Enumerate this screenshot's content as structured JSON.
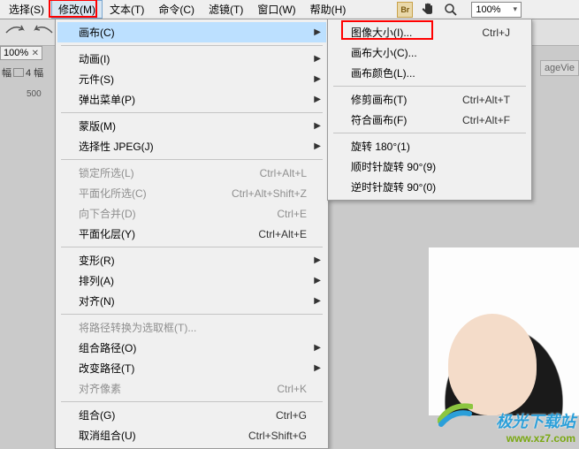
{
  "menubar": {
    "items": [
      {
        "label": "选择(S)"
      },
      {
        "label": "修改(M)",
        "open": true
      },
      {
        "label": "文本(T)"
      },
      {
        "label": "命令(C)"
      },
      {
        "label": "滤镜(T)"
      },
      {
        "label": "窗口(W)"
      },
      {
        "label": "帮助(H)"
      }
    ],
    "zoom": "100%"
  },
  "left": {
    "tab": "100%",
    "frames_left_label": "幅",
    "frames_right_label": "4 幅",
    "ruler_value": "500"
  },
  "side_right": {
    "label": "ageVie"
  },
  "watermark": {
    "cn": "极光下载站",
    "url": "www.xz7.com"
  },
  "dropdown_main": {
    "groups": [
      [
        {
          "label": "画布(C)",
          "arrow": true,
          "hover": true
        }
      ],
      [
        {
          "label": "动画(I)",
          "arrow": true
        },
        {
          "label": "元件(S)",
          "arrow": true
        },
        {
          "label": "弹出菜单(P)",
          "arrow": true
        }
      ],
      [
        {
          "label": "蒙版(M)",
          "arrow": true
        },
        {
          "label": "选择性 JPEG(J)",
          "arrow": true
        }
      ],
      [
        {
          "label": "锁定所选(L)",
          "shortcut": "Ctrl+Alt+L",
          "disabled": true
        },
        {
          "label": "平面化所选(C)",
          "shortcut": "Ctrl+Alt+Shift+Z",
          "disabled": true
        },
        {
          "label": "向下合并(D)",
          "shortcut": "Ctrl+E",
          "disabled": true
        },
        {
          "label": "平面化层(Y)",
          "shortcut": "Ctrl+Alt+E"
        }
      ],
      [
        {
          "label": "变形(R)",
          "arrow": true
        },
        {
          "label": "排列(A)",
          "arrow": true
        },
        {
          "label": "对齐(N)",
          "arrow": true
        }
      ],
      [
        {
          "label": "将路径转换为选取框(T)...",
          "disabled": true
        },
        {
          "label": "组合路径(O)",
          "arrow": true
        },
        {
          "label": "改变路径(T)",
          "arrow": true
        },
        {
          "label": "对齐像素",
          "shortcut": "Ctrl+K",
          "disabled": true
        }
      ],
      [
        {
          "label": "组合(G)",
          "shortcut": "Ctrl+G"
        },
        {
          "label": "取消组合(U)",
          "shortcut": "Ctrl+Shift+G"
        }
      ]
    ]
  },
  "dropdown_sub": {
    "groups": [
      [
        {
          "label": "图像大小(I)...",
          "shortcut": "Ctrl+J"
        },
        {
          "label": "画布大小(C)..."
        },
        {
          "label": "画布颜色(L)..."
        }
      ],
      [
        {
          "label": "修剪画布(T)",
          "shortcut": "Ctrl+Alt+T"
        },
        {
          "label": "符合画布(F)",
          "shortcut": "Ctrl+Alt+F"
        }
      ],
      [
        {
          "label": "旋转 180°(1)"
        },
        {
          "label": "顺时针旋转 90°(9)"
        },
        {
          "label": "逆时针旋转 90°(0)"
        }
      ]
    ]
  }
}
